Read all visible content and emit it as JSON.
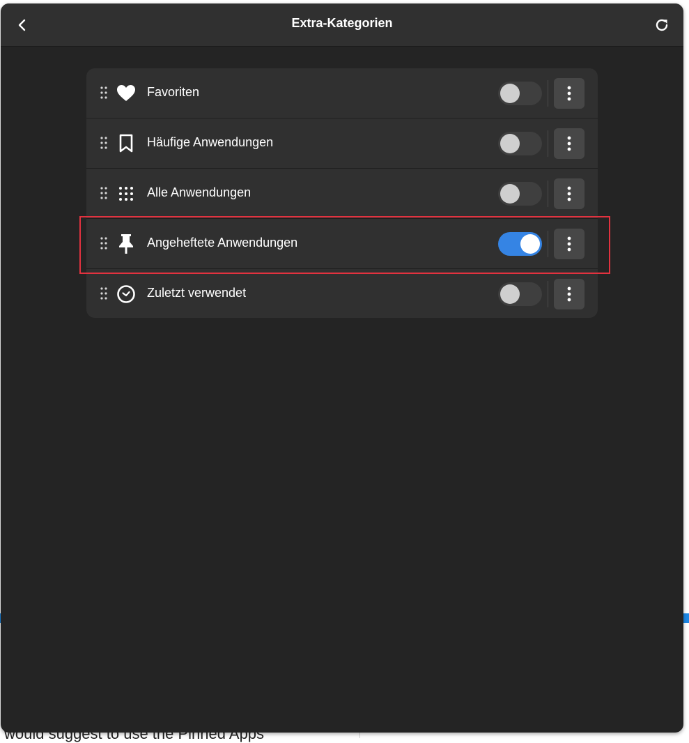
{
  "dialog": {
    "title": "Extra-Kategorien",
    "back_icon": "chevron-left-icon",
    "refresh_icon": "refresh-icon"
  },
  "categories": [
    {
      "label": "Favoriten",
      "icon": "heart-icon",
      "enabled": false
    },
    {
      "label": "Häufige Anwendungen",
      "icon": "bookmark-icon",
      "enabled": false
    },
    {
      "label": "Alle Anwendungen",
      "icon": "app-grid-icon",
      "enabled": false
    },
    {
      "label": "Angeheftete Anwendungen",
      "icon": "pin-icon",
      "enabled": true
    },
    {
      "label": "Zuletzt verwendet",
      "icon": "clock-icon",
      "enabled": false
    }
  ],
  "background": {
    "text": "would suggest to use the Pinned Apps"
  },
  "colors": {
    "dialog_bg": "#242424",
    "header_bg": "#303030",
    "card_bg": "#303030",
    "toggle_on": "#3584e4",
    "highlight": "#e2323f"
  }
}
